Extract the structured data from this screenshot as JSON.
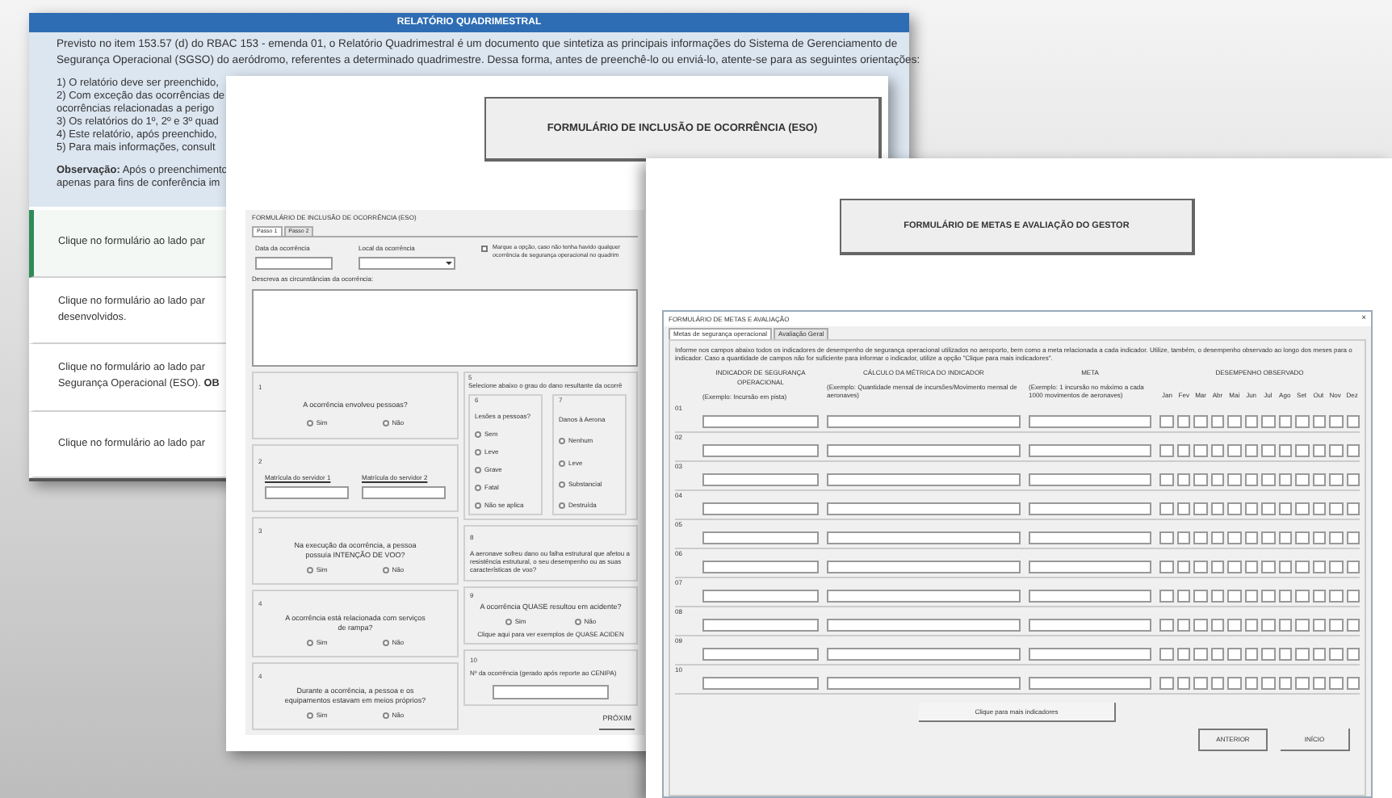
{
  "report_window": {
    "title": "RELATÓRIO QUADRIMESTRAL",
    "intro_lines": [
      "Previsto no item 153.57 (d) do RBAC 153 - emenda 01, o Relatório Quadrimestral é um documento que sintetiza as principais informações do Sistema de Gerenciamento de",
      "Segurança Operacional (SGSO) do aeródromo, referentes a determinado quadrimestre. Dessa forma, antes de preenchê-lo ou enviá-lo, atente-se para as seguintes orientações:"
    ],
    "item_lines": [
      "1) O relatório deve ser preenchido,",
      "2) Com exceção das ocorrências de",
      "ocorrências relacionadas a perigo",
      "3) Os relatórios do 1º, 2º e 3º quad",
      "4) Este relatório, após preenchido,",
      "5) Para mais informações, consult"
    ],
    "note_lines": [
      "**Observação:** Após o preenchimento",
      "apenas para fins de conferência im"
    ],
    "links": [
      {
        "lines": [
          "Clique no formulário ao lado par"
        ],
        "highlighted": true
      },
      {
        "lines": [
          "Clique no formulário ao lado par",
          "desenvolvidos."
        ],
        "highlighted": false
      },
      {
        "lines": [
          "Clique no formulário ao lado par",
          "Segurança Operacional (ESO). **OB**"
        ],
        "highlighted": false
      },
      {
        "lines": [
          "Clique no formulário ao lado par"
        ],
        "highlighted": false
      }
    ]
  },
  "occurrence_form": {
    "header_button": "FORMULÁRIO DE INCLUSÃO DE OCORRÊNCIA (ESO)",
    "caption": "FORMULÁRIO DE INCLUSÃO DE OCORRÊNCIA (ESO)",
    "tabs": [
      {
        "label": "Passo 1",
        "selected": true
      },
      {
        "label": "Passo 2",
        "selected": false
      }
    ],
    "date_label": "Data da ocorrência",
    "location_label": "Local da ocorrência",
    "no_occurrence": {
      "lines": [
        "Marque a opção, caso não tenha havido qualquer",
        "ocorrência de segurança operacional no quadrim"
      ],
      "checked": false
    },
    "description_label": "Descreva as circunstâncias da ocorrência:",
    "left_frames": [
      {
        "number": "1",
        "kind": "question",
        "question": "A ocorrência envolveu pessoas?",
        "options": [
          {
            "label": "Sim",
            "selected": false
          },
          {
            "label": "Não",
            "selected": false
          }
        ]
      },
      {
        "number": "2",
        "kind": "fields",
        "fields": [
          "Matrícula do servidor 1",
          "Matrícula do servidor 2"
        ]
      },
      {
        "number": "3",
        "kind": "question",
        "question": "Na execução da ocorrência, a pessoa possuía INTENÇÃO DE VOO?",
        "options": [
          {
            "label": "Sim",
            "selected": false
          },
          {
            "label": "Não",
            "selected": false
          }
        ]
      },
      {
        "number": "4",
        "kind": "question",
        "question": "A ocorrência está relacionada com serviços de rampa?",
        "options": [
          {
            "label": "Sim",
            "selected": false
          },
          {
            "label": "Não",
            "selected": false
          }
        ]
      },
      {
        "number": "4",
        "kind": "question",
        "question": "Durante a ocorrência, a pessoa e os equipamentos estavam em meios próprios?",
        "options": [
          {
            "label": "Sim",
            "selected": false
          },
          {
            "label": "Não",
            "selected": false
          }
        ]
      }
    ],
    "damage": {
      "number": "5",
      "label": "Selecione abaixo o grau do dano resultante da ocorrê",
      "groups": [
        {
          "number": "6",
          "title": "Lesões a pessoas?",
          "options": [
            {
              "label": "Sem",
              "selected": false
            },
            {
              "label": "Leve",
              "selected": false
            },
            {
              "label": "Grave",
              "selected": false
            },
            {
              "label": "Fatal",
              "selected": false
            },
            {
              "label": "Não se aplica",
              "selected": false
            }
          ]
        },
        {
          "number": "7",
          "title": "Danos à Aerona",
          "options": [
            {
              "label": "Nenhum",
              "selected": false
            },
            {
              "label": "Leve",
              "selected": false
            },
            {
              "label": "Substancial",
              "selected": false
            },
            {
              "label": "Destruída",
              "selected": false
            }
          ]
        }
      ]
    },
    "right_frames": [
      {
        "number": "8",
        "kind": "statement",
        "question": "A aeronave sofreu dano ou falha estrutural que afetou a resistência estrutural, o seu desempenho ou as suas características de voo?"
      },
      {
        "number": "9",
        "kind": "question",
        "question": "A ocorrência QUASE resultou em acidente?",
        "options": [
          {
            "label": "Sim",
            "selected": false
          },
          {
            "label": "Não",
            "selected": false
          }
        ],
        "link": "Clique aqui para ver exemplos de QUASE ACIDEN"
      },
      {
        "number": "10",
        "kind": "field",
        "question": "Nº da ocorrência (gerado após reporte ao CENIPA)"
      }
    ],
    "next_button": "PRÓXIM"
  },
  "goals_form": {
    "header_button": "FORMULÁRIO DE METAS E AVALIAÇÃO DO GESTOR",
    "caption": "FORMULÁRIO DE METAS E AVALIAÇÃO",
    "close": "×",
    "tabs": [
      {
        "label": "Metas de segurança operacional",
        "selected": true
      },
      {
        "label": "Avaliação Geral",
        "selected": false
      }
    ],
    "instructions": "Informe nos campos abaixo todos os indicadores de desempenho de segurança operacional utilizados no aeroporto, bem como a meta relacionada a cada indicador. Utilize, também, o desempenho observado ao longo dos meses para o indicador. Caso a quantidade de campos não for suficiente para informar o indicador, utilize a opção \"Clique para mais indicadores\".",
    "columns": [
      {
        "title": "INDICADOR DE SEGURANÇA OPERACIONAL",
        "example": "(Exemplo: Incursão em pista)"
      },
      {
        "title": "CÁLCULO DA MÉTRICA DO INDICADOR",
        "example": "(Exemplo: Quantidade mensal de incursões/Movimento mensal de aeronaves)"
      },
      {
        "title": "META",
        "example": "(Exemplo: 1 incursão no máximo a cada 1000 movimentos de aeronaves)"
      }
    ],
    "performance_title": "DESEMPENHO OBSERVADO",
    "months": [
      "Jan",
      "Fev",
      "Mar",
      "Abr",
      "Mai",
      "Jun",
      "Jul",
      "Ago",
      "Set",
      "Out",
      "Nov",
      "Dez"
    ],
    "rows": [
      "01",
      "02",
      "03",
      "04",
      "05",
      "06",
      "07",
      "08",
      "09",
      "10"
    ],
    "more_button": "Clique para mais indicadores",
    "buttons": [
      "ANTERIOR",
      "INÍCIO"
    ]
  }
}
